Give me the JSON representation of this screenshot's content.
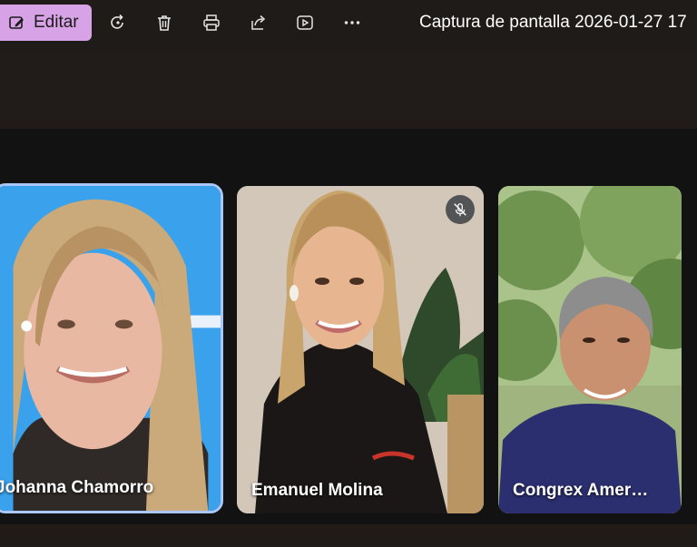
{
  "toolbar": {
    "edit_label": "Editar",
    "icons": [
      "edit-icon",
      "rotate-icon",
      "delete-icon",
      "print-icon",
      "share-icon",
      "slideshow-icon",
      "more-icon"
    ]
  },
  "window": {
    "title": "Captura de pantalla 2026-01-27 17"
  },
  "participants": [
    {
      "name": "Johanna Chamorro",
      "active_speaker": true,
      "muted": false
    },
    {
      "name": "Emanuel Molina",
      "active_speaker": false,
      "muted": true
    },
    {
      "name": "Congrex Amer…",
      "active_speaker": false,
      "muted": false
    }
  ],
  "colors": {
    "accent": "#d7a3e6",
    "active_border": "#a9c7fa",
    "background": "#1f1b18",
    "stage": "#121212"
  }
}
